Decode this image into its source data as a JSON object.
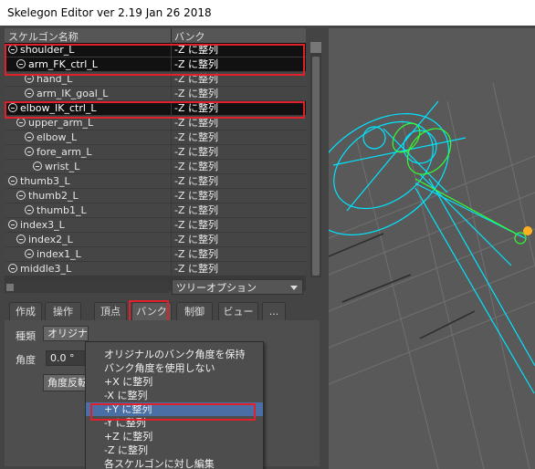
{
  "window": {
    "title": "Skelegon Editor ver 2.19 Jan 26 2018"
  },
  "tree": {
    "col_name": "スケルゴン名称",
    "col_bank": "バンク",
    "rows": [
      {
        "name": "shoulder_L",
        "bank": "-Z に整列",
        "indent": 0,
        "selected": true
      },
      {
        "name": "arm_FK_ctrl_L",
        "bank": "-Z に整列",
        "indent": 1,
        "selected": true
      },
      {
        "name": "hand_L",
        "bank": "-Z に整列",
        "indent": 2,
        "selected": false
      },
      {
        "name": "arm_IK_goal_L",
        "bank": "-Z に整列",
        "indent": 2,
        "selected": false
      },
      {
        "name": "elbow_IK_ctrl_L",
        "bank": "-Z に整列",
        "indent": 0,
        "selected": true
      },
      {
        "name": "upper_arm_L",
        "bank": "-Z に整列",
        "indent": 1,
        "selected": false
      },
      {
        "name": "elbow_L",
        "bank": "-Z に整列",
        "indent": 2,
        "selected": false
      },
      {
        "name": "fore_arm_L",
        "bank": "-Z に整列",
        "indent": 2,
        "selected": false
      },
      {
        "name": "wrist_L",
        "bank": "-Z に整列",
        "indent": 3,
        "selected": false
      },
      {
        "name": "thumb3_L",
        "bank": "-Z に整列",
        "indent": 0,
        "selected": false
      },
      {
        "name": "thumb2_L",
        "bank": "-Z に整列",
        "indent": 1,
        "selected": false
      },
      {
        "name": "thumb1_L",
        "bank": "-Z に整列",
        "indent": 2,
        "selected": false
      },
      {
        "name": "index3_L",
        "bank": "-Z に整列",
        "indent": 0,
        "selected": false
      },
      {
        "name": "index2_L",
        "bank": "-Z に整列",
        "indent": 1,
        "selected": false
      },
      {
        "name": "index1_L",
        "bank": "-Z に整列",
        "indent": 2,
        "selected": false
      },
      {
        "name": "middle3_L",
        "bank": "-Z に整列",
        "indent": 0,
        "selected": false
      }
    ],
    "tree_option": "ツリーオプション"
  },
  "tabs": [
    {
      "label": "作成",
      "active": false
    },
    {
      "label": "操作",
      "active": false
    },
    {
      "label": "頂点",
      "active": false
    },
    {
      "label": "バンク",
      "active": true
    },
    {
      "label": "制御",
      "active": false
    },
    {
      "label": "ビュー",
      "active": false
    },
    {
      "label": "...",
      "active": false
    }
  ],
  "panel": {
    "type_label": "種類",
    "type_value": "オリジナ",
    "angle_label": "角度",
    "angle_value": "0.0 °",
    "reverse_button": "角度反転"
  },
  "menu": {
    "items": [
      {
        "label": "オリジナルのバンク角度を保持",
        "highlighted": false
      },
      {
        "label": "バンク角度を使用しない",
        "highlighted": false
      },
      {
        "label": "+X に整列",
        "highlighted": false
      },
      {
        "label": "-X に整列",
        "highlighted": false
      },
      {
        "label": "+Y に整列",
        "highlighted": true
      },
      {
        "label": "-Y に整列",
        "highlighted": false
      },
      {
        "label": "+Z に整列",
        "highlighted": false
      },
      {
        "label": "-Z に整列",
        "highlighted": false
      },
      {
        "label": "各スケルゴンに対し編集",
        "highlighted": false
      }
    ]
  },
  "colors": {
    "highlight_box": "#e0202a",
    "menu_highlight": "#4a6fa5",
    "wireframe": "#00e5ff",
    "joint": "#33ff33"
  }
}
